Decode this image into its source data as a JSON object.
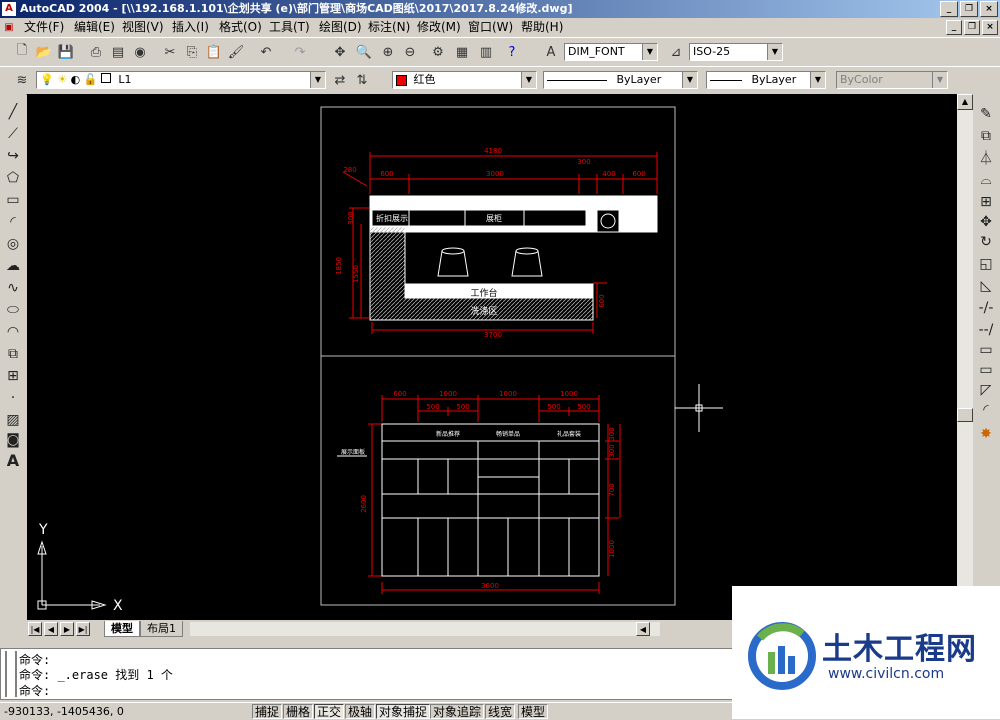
{
  "window": {
    "title": "AutoCAD 2004 - [\\\\192.168.1.101\\企划共享 (e)\\部门管理\\商场CAD图纸\\2017\\2017.8.24修改.dwg]"
  },
  "menu": [
    "文件(F)",
    "编辑(E)",
    "视图(V)",
    "插入(I)",
    "格式(O)",
    "工具(T)",
    "绘图(D)",
    "标注(N)",
    "修改(M)",
    "窗口(W)",
    "帮助(H)"
  ],
  "toolbar": {
    "text_style": "DIM_FONT",
    "dim_style": "ISO-25"
  },
  "layers": {
    "current": "L1",
    "color": "红色",
    "linetype": "ByLayer",
    "lineweight": "ByLayer",
    "plotstyle": "ByColor"
  },
  "colors": {
    "canvas": "#000000",
    "dim": "#ff0000",
    "geom": "#ffffff",
    "accent": "#0a246a"
  },
  "tabs": {
    "model": "模型",
    "layout": "布局1"
  },
  "ucs": {
    "y": "Y",
    "x": "X"
  },
  "plan": {
    "dims": {
      "total_width": "4180",
      "seg1": "600",
      "seg2": "3000",
      "seg3": "300",
      "seg4": "400",
      "seg5": "600",
      "left_tag": "280",
      "depth": "300",
      "height1": "1850",
      "height2": "1550",
      "bottom": "3700",
      "right_h": "600"
    },
    "labels": {
      "cabinet1": "折扣展示",
      "cabinet2": "展柜",
      "workbench": "工作台",
      "sink_area": "洗涤区"
    }
  },
  "elevation": {
    "dims": {
      "t1": "600",
      "t2": "1000",
      "t3": "1000",
      "t4": "1000",
      "s1": "500",
      "s2": "500",
      "s3": "500",
      "s4": "500",
      "left": "2600",
      "r1": "300",
      "r2": "300",
      "r3": "700",
      "r4": "1000",
      "bottom": "3600"
    },
    "labels": {
      "side": "展示面板",
      "h1": "新品推荐",
      "h2": "畅销单品",
      "h3": "礼品套装"
    }
  },
  "command": {
    "line1": "命令:",
    "line2": "命令: _.erase 找到 1 个",
    "line3": "命令:"
  },
  "status": {
    "coords": "-930133, -1405436, 0",
    "buttons": [
      "捕捉",
      "栅格",
      "正交",
      "极轴",
      "对象捕捉",
      "对象追踪",
      "线宽",
      "模型"
    ]
  },
  "watermark": {
    "brand": "土木工程网",
    "url": "www.civilcn.com"
  }
}
